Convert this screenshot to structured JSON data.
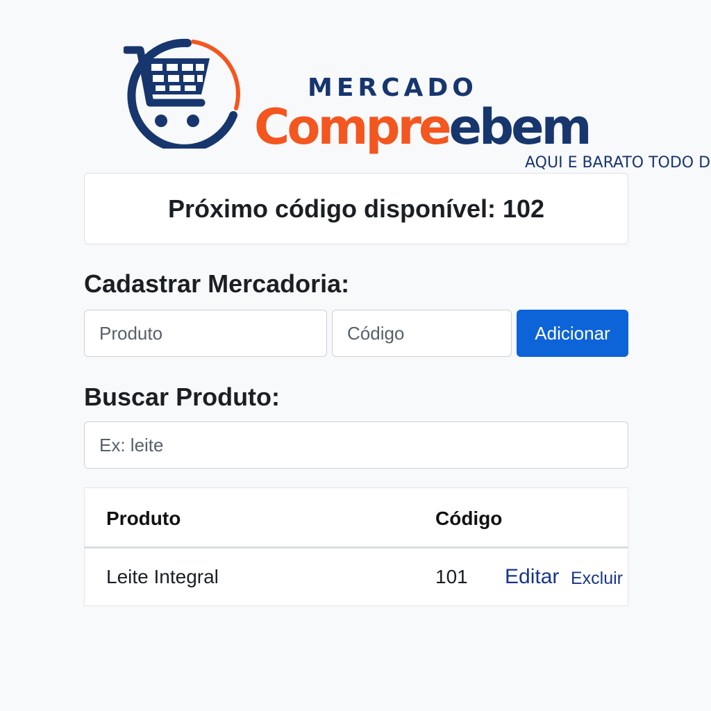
{
  "brand": {
    "prefix": "MERCADO",
    "name_part1": "Compre",
    "name_part2": "ebem",
    "tagline": "AQUI E BARATO TODO DIA!",
    "colors": {
      "orange": "#f4561f",
      "navy": "#17366e"
    },
    "icon": "shopping-cart-icon"
  },
  "next_code": {
    "text": "Próximo código disponível: 102"
  },
  "register": {
    "heading": "Cadastrar Mercadoria:",
    "product_placeholder": "Produto",
    "code_placeholder": "Código",
    "add_label": "Adicionar",
    "accent": "#0d63d8"
  },
  "search": {
    "heading": "Buscar Produto:",
    "placeholder": "Ex: leite"
  },
  "table": {
    "headers": [
      "Produto",
      "Código"
    ],
    "rows": [
      {
        "product": "Leite Integral",
        "code": "101",
        "edit_label": "Editar",
        "delete_label": "Excluir"
      }
    ]
  }
}
